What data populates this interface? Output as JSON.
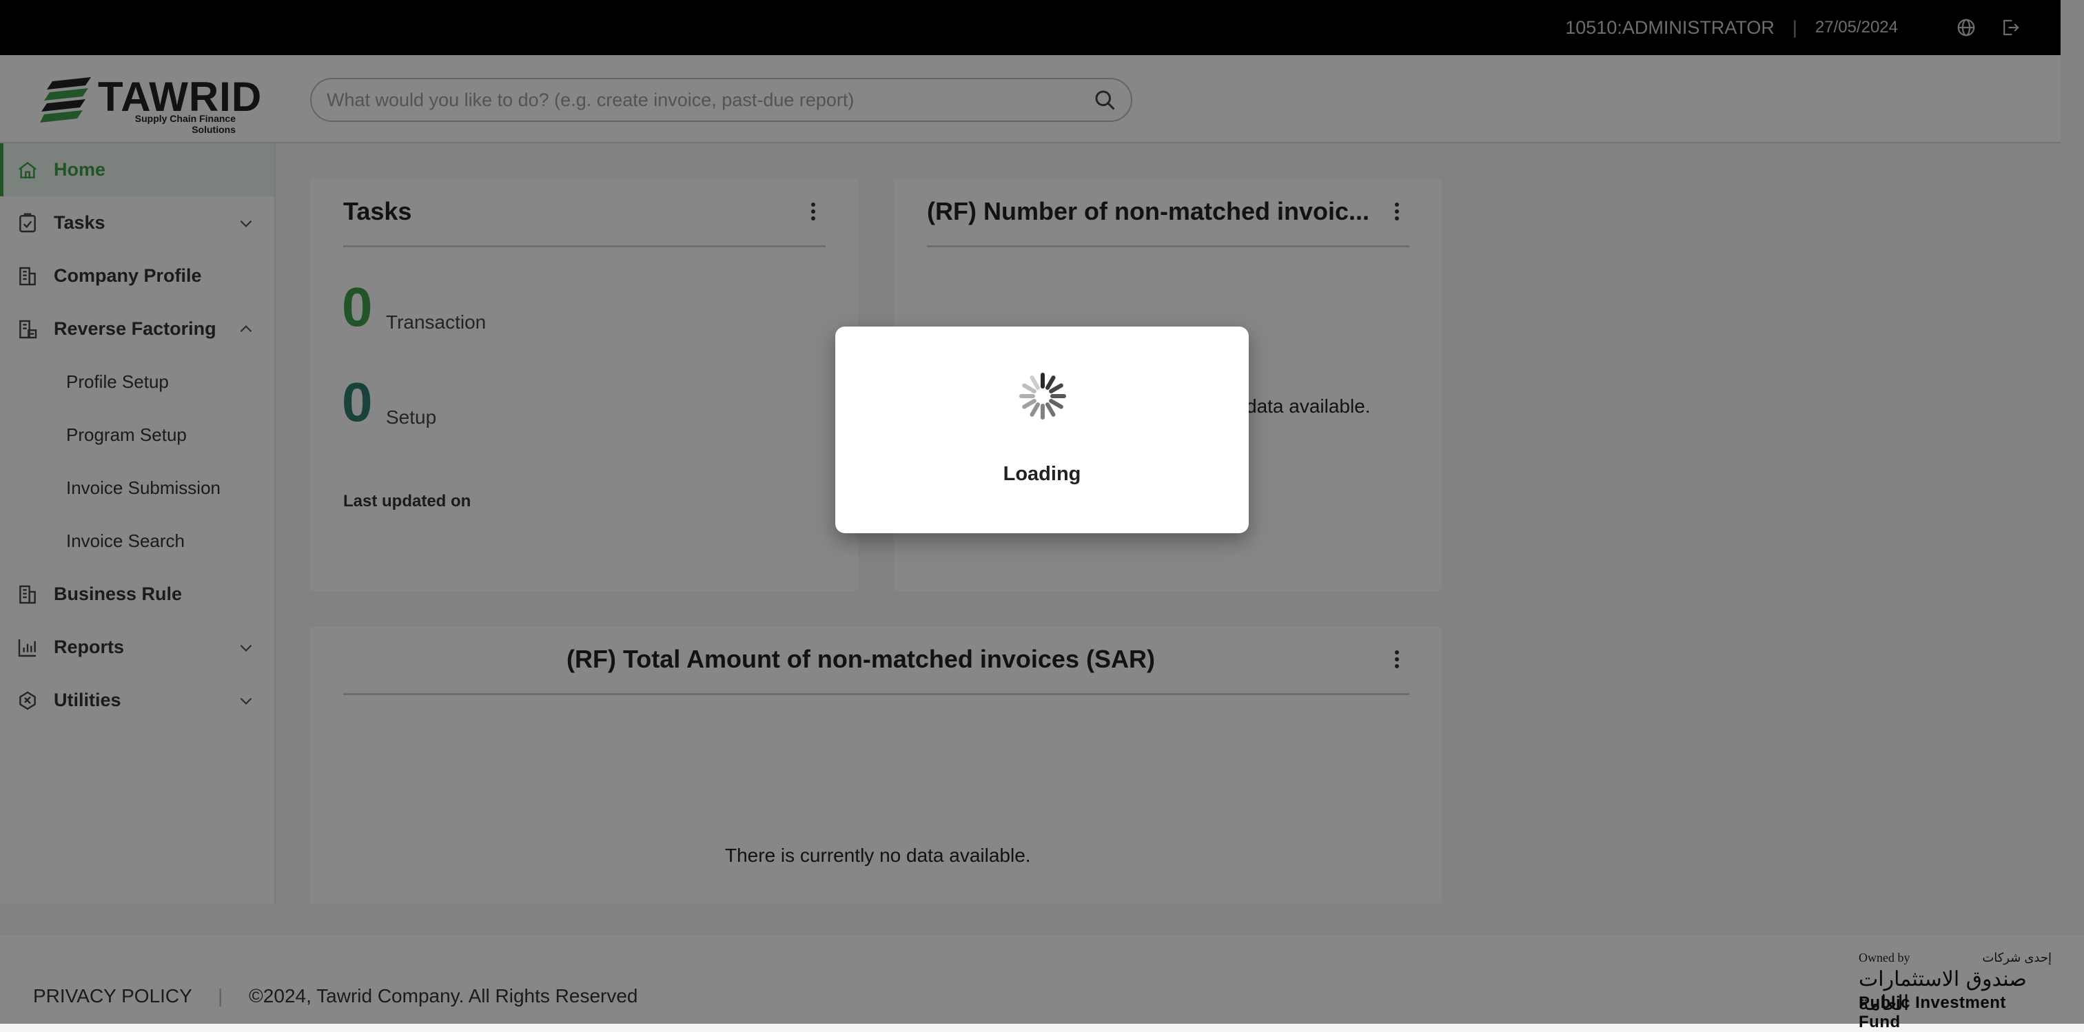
{
  "topbar": {
    "user": "10510:ADMINISTRATOR",
    "separator": "|",
    "date": "27/05/2024",
    "icons": [
      "globe-icon",
      "logout-icon"
    ]
  },
  "header": {
    "logo_text": "TAWRID",
    "logo_tagline": "Supply Chain Finance Solutions",
    "search_placeholder": "What would you like to do? (e.g. create invoice, past-due report)"
  },
  "sidebar": {
    "items": [
      {
        "label": "Home",
        "icon": "home-icon",
        "active": true
      },
      {
        "label": "Tasks",
        "icon": "clipboard-check-icon",
        "expandable": true
      },
      {
        "label": "Company Profile",
        "icon": "building-icon"
      },
      {
        "label": "Reverse Factoring",
        "icon": "bank-icon",
        "expanded": true
      },
      {
        "label": "Business Rule",
        "icon": "building-icon"
      },
      {
        "label": "Reports",
        "icon": "bar-chart-icon",
        "expandable": true
      },
      {
        "label": "Utilities",
        "icon": "tools-icon",
        "expandable": true
      }
    ],
    "reverse_factoring_sub": [
      "Profile Setup",
      "Program Setup",
      "Invoice Submission",
      "Invoice Search"
    ]
  },
  "widgets": {
    "tasks": {
      "title": "Tasks",
      "transaction_count": "0",
      "transaction_label": "Transaction",
      "setup_count": "0",
      "setup_label": "Setup",
      "last_updated": "Last updated on"
    },
    "rf_number": {
      "title": "(RF) Number of non-matched invoic...",
      "no_data": "There is currently no data available."
    },
    "rf_total": {
      "title": "(RF) Total Amount of non-matched invoices (SAR)",
      "no_data": "There is currently no data available."
    }
  },
  "footer": {
    "privacy": "PRIVACY POLICY",
    "separator": "|",
    "copyright": "©2024, Tawrid Company. All Rights Reserved",
    "pif_owned_by": "Owned by",
    "pif_arabic_small": "إحدى شركات",
    "pif_arabic": "صندوق الاستثمارات العامة",
    "pif_english": "Public Investment Fund"
  },
  "modal": {
    "text": "Loading"
  },
  "colors": {
    "accent_green": "#3f9f49",
    "teal": "#2f7e6e",
    "topbar": "#000000"
  }
}
